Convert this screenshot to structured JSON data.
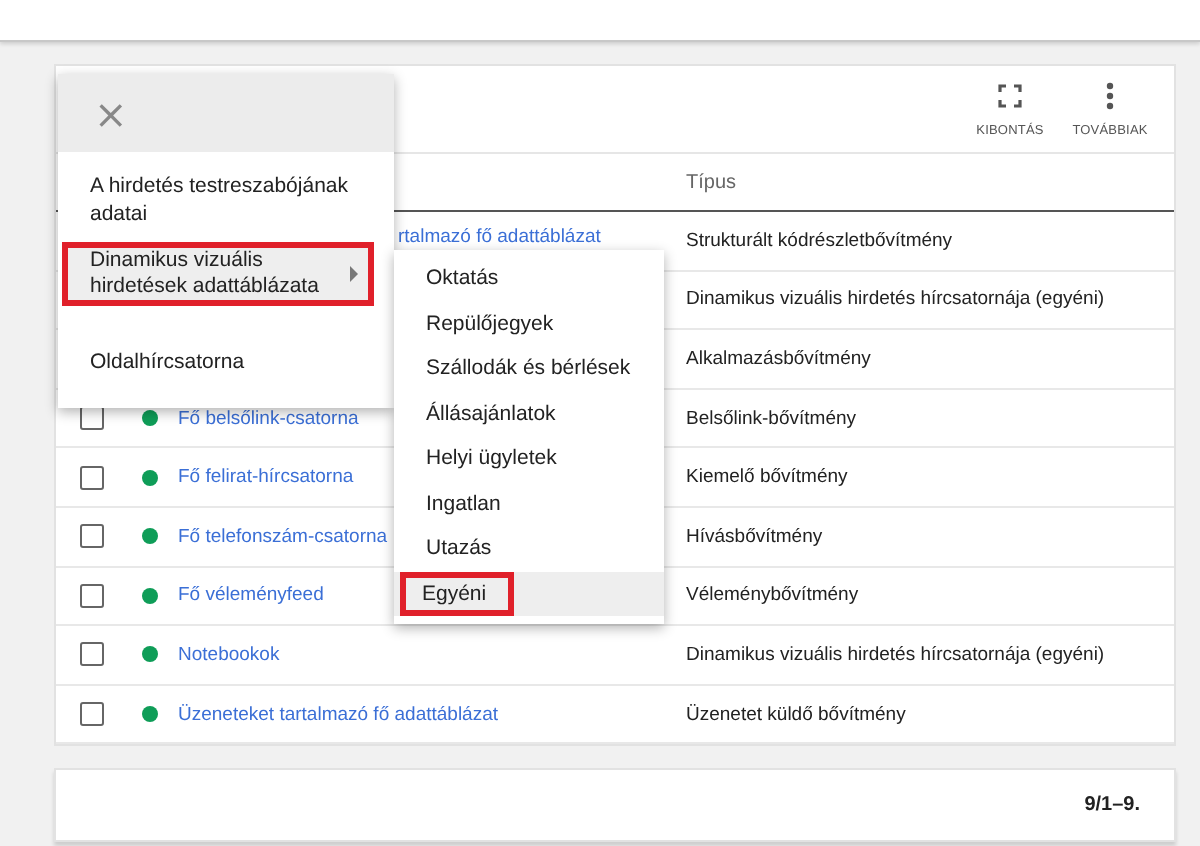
{
  "toolbar": [
    {
      "kind": "expand",
      "label": "KIBONTÁS"
    },
    {
      "kind": "more",
      "label": "TOVÁBBIAK"
    }
  ],
  "table": {
    "columns": [
      "Típus"
    ],
    "rows": [
      {
        "name": "rtalmazó fő adattáblázat",
        "type": "Strukturált kódrészletbővítmény"
      },
      {
        "type": "Dinamikus vizuális hirdetés hírcsatornája (egyéni)"
      },
      {
        "type": "Alkalmazásbővítmény"
      },
      {
        "checked": false,
        "color": "#0f9d58",
        "name": "Fő belsőlink-csatorna",
        "type": "Belsőlink-bővítmény"
      },
      {
        "checked": false,
        "color": "#0f9d58",
        "name": "Fő felirat-hírcsatorna",
        "type": "Kiemelő bővítmény"
      },
      {
        "checked": false,
        "color": "#0f9d58",
        "name": "Fő telefonszám-csatorna",
        "type": "Hívásbővítmény"
      },
      {
        "checked": false,
        "color": "#0f9d58",
        "name": "Fő véleményfeed",
        "type": "Véleménybővítmény"
      },
      {
        "checked": false,
        "color": "#0f9d58",
        "name": "Notebookok",
        "type": "Dinamikus vizuális hirdetés hírcsatornája (egyéni)"
      },
      {
        "checked": false,
        "color": "#0f9d58",
        "name": "Üzeneteket tartalmazó fő adattáblázat",
        "type": "Üzenetet küldő bővítmény"
      }
    ]
  },
  "pagination": "9/1–9.",
  "menu": {
    "close": "×",
    "items": [
      {
        "label": "A hirdetés testreszabójának adatai",
        "selected": false,
        "outlined": false
      },
      {
        "label": "Dinamikus vizuális hirdetések adattáblázata",
        "selected": true,
        "outlined": true,
        "kind": "submenu"
      },
      {
        "label": "Oldalhírcsatorna",
        "selected": false,
        "outlined": false
      }
    ]
  },
  "submenu": {
    "items": [
      {
        "label": "Oktatás",
        "selected": false,
        "outlined": false
      },
      {
        "label": "Repülőjegyek",
        "selected": false,
        "outlined": false
      },
      {
        "label": "Szállodák és bérlések",
        "selected": false,
        "outlined": false
      },
      {
        "label": "Állásajánlatok",
        "selected": false,
        "outlined": false
      },
      {
        "label": "Helyi ügyletek",
        "selected": false,
        "outlined": false
      },
      {
        "label": "Ingatlan",
        "selected": false,
        "outlined": false
      },
      {
        "label": "Utazás",
        "selected": false,
        "outlined": false
      },
      {
        "label": "Egyéni",
        "selected": true,
        "outlined": true
      }
    ]
  }
}
